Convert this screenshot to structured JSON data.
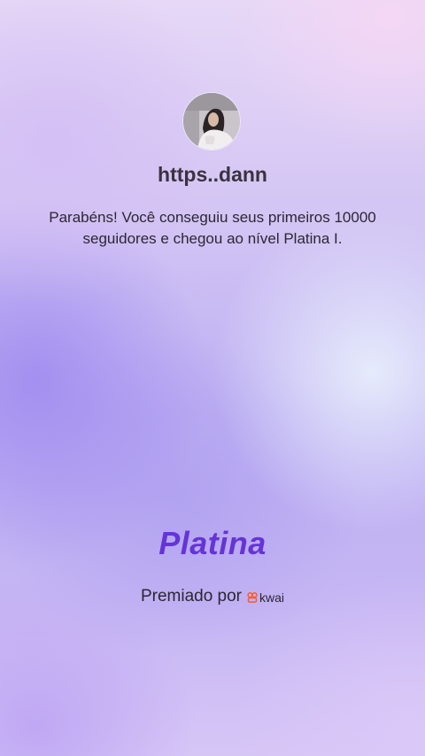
{
  "profile": {
    "username": "https..dann"
  },
  "message": "Parabéns! Você conseguiu seus primeiros 10000 seguidores e chegou ao nível Platina I.",
  "level": {
    "name": "Platina"
  },
  "award": {
    "prefix": "Premiado por",
    "brand": "kwai",
    "brand_color": "#ff5a1f"
  },
  "colors": {
    "level_text": "#6534d6",
    "username_text": "#3a3340"
  },
  "icons": [
    "kwai-logo-icon"
  ]
}
